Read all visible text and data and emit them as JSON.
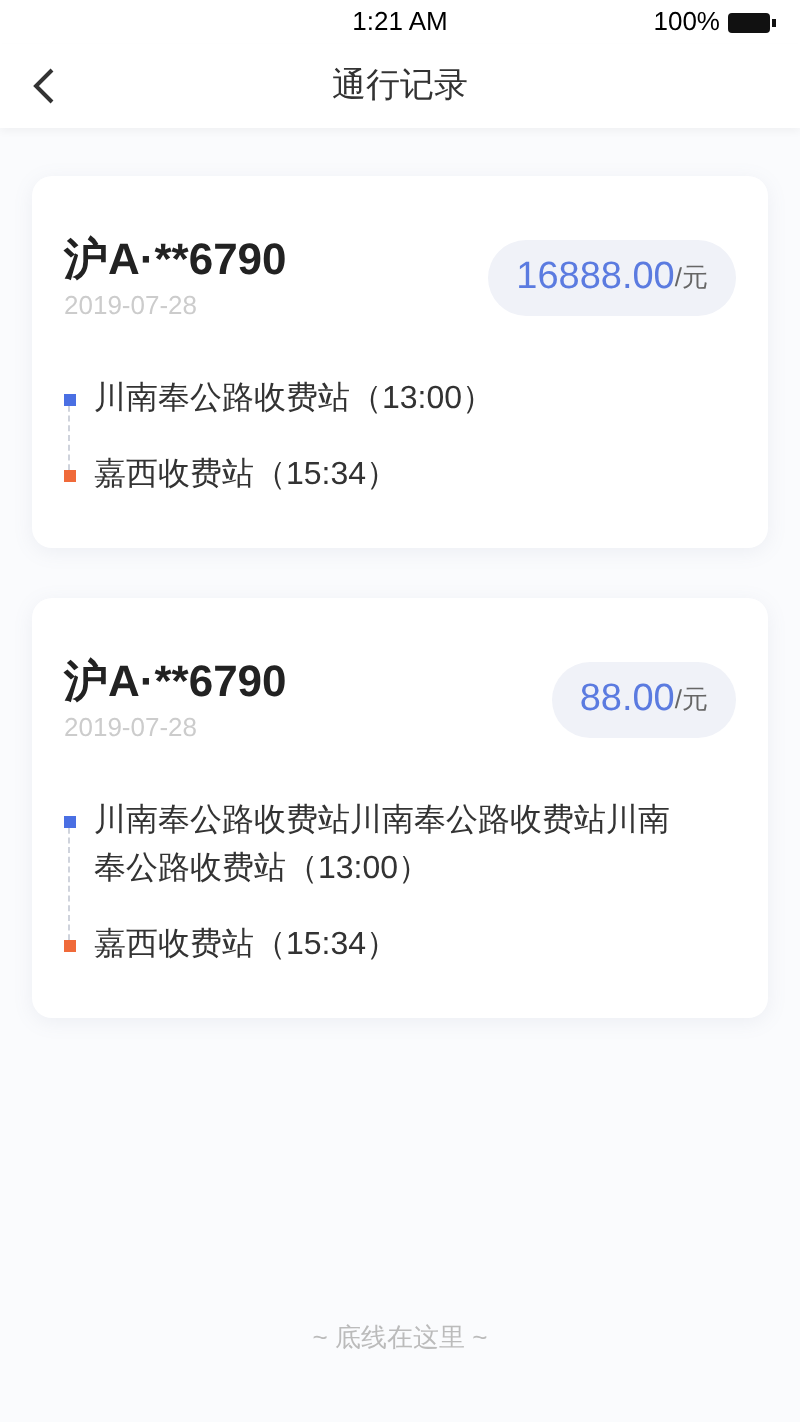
{
  "status_bar": {
    "time": "1:21 AM",
    "battery": "100%"
  },
  "nav": {
    "title": "通行记录"
  },
  "records": [
    {
      "plate": "沪A·**6790",
      "date": "2019-07-28",
      "amount": "16888.00",
      "unit": "/元",
      "stations": [
        {
          "name": "川南奉公路收费站（13:00）",
          "color": "#4a6fe3"
        },
        {
          "name": "嘉西收费站（15:34）",
          "color": "#f06a3a"
        }
      ]
    },
    {
      "plate": "沪A·**6790",
      "date": "2019-07-28",
      "amount": "88.00",
      "unit": "/元",
      "stations": [
        {
          "name": "川南奉公路收费站川南奉公路收费站川南奉公路收费站（13:00）",
          "color": "#4a6fe3"
        },
        {
          "name": "嘉西收费站（15:34）",
          "color": "#f06a3a"
        }
      ]
    }
  ],
  "footer": "~ 底线在这里 ~"
}
